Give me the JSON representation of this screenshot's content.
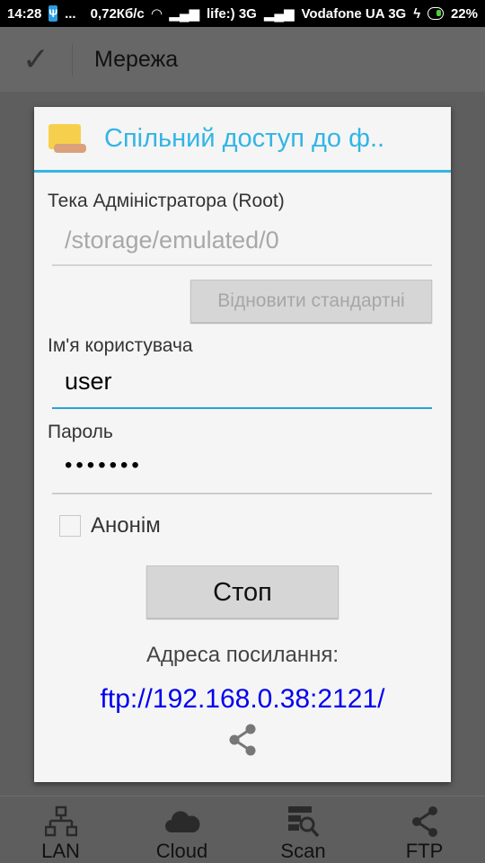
{
  "status_bar": {
    "time": "14:28",
    "dots": "...",
    "speed": "0,72Кб/с",
    "carrier1": "life:) 3G",
    "carrier2": "Vodafone UA 3G",
    "battery": "22%"
  },
  "app_bar": {
    "title": "Мережа"
  },
  "dialog": {
    "title": "Спільний доступ до ф..",
    "root_label": "Тека Адміністратора (Root)",
    "root_value": "/storage/emulated/0",
    "restore_button": "Відновити стандартні",
    "username_label": "Ім'я користувача",
    "username_value": "user",
    "password_label": "Пароль",
    "password_value": "•••••••",
    "anonymous_label": "Анонім",
    "anonymous_checked": false,
    "stop_button": "Стоп",
    "address_label": "Адреса посилання:",
    "address_url": "ftp://192.168.0.38:2121/"
  },
  "accent": "#33b5e5",
  "link_color": "#0000ee",
  "bottom_nav": [
    {
      "label": "LAN",
      "icon": "lan-icon"
    },
    {
      "label": "Cloud",
      "icon": "cloud-icon"
    },
    {
      "label": "Scan",
      "icon": "scan-icon"
    },
    {
      "label": "FTP",
      "icon": "share-icon"
    }
  ]
}
